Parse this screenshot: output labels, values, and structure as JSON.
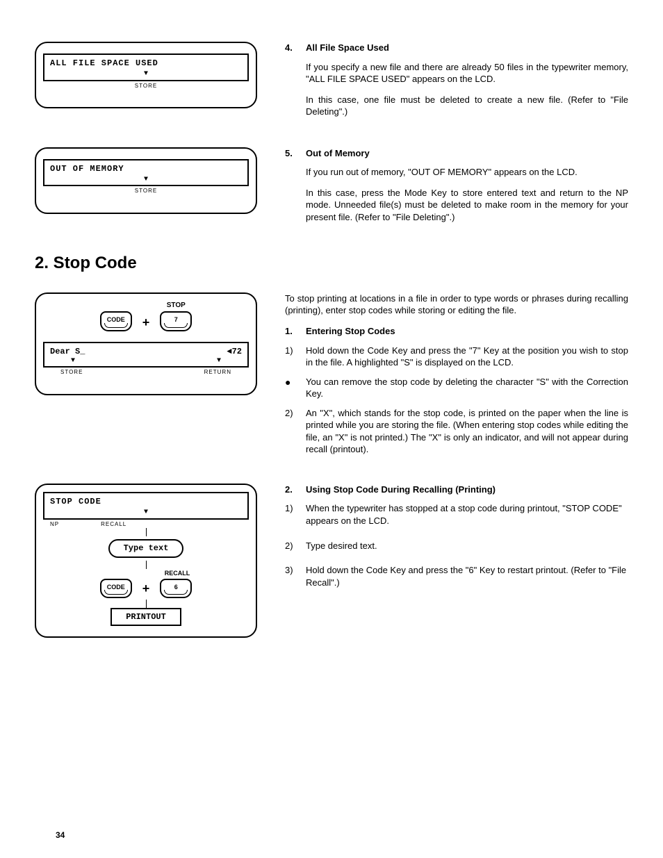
{
  "lcd1": {
    "text": "ALL FILE SPACE USED",
    "sublabel": "STORE"
  },
  "sec4": {
    "num": "4.",
    "title": "All File Space Used",
    "p1": "If you specify a new file and there are already 50 files in the typewriter memory, \"ALL FILE SPACE USED\" appears on the LCD.",
    "p2": "In this case, one file must be deleted to create a new file. (Refer to \"File Deleting\".)"
  },
  "lcd2": {
    "text": "OUT OF MEMORY",
    "sublabel": "STORE"
  },
  "sec5": {
    "num": "5.",
    "title": "Out of Memory",
    "p1": "If you run out of memory, \"OUT OF MEMORY\" appears on the LCD.",
    "p2": "In this case, press the Mode Key to store entered text and return to the NP mode. Unneeded file(s) must be deleted to make room in the memory for your present file. (Refer to \"File Deleting\".)"
  },
  "section2": {
    "title": "2.   Stop Code",
    "intro": "To stop printing at locations in a file in order to type words or phrases during recalling (printing), enter stop codes while storing or editing the file."
  },
  "diag1": {
    "stopLabel": "STOP",
    "keyCode": "CODE",
    "key7": "7",
    "lcdLeft": "Dear S_",
    "lcdRight": "◄72",
    "sublabelL": "STORE",
    "sublabelR": "RETURN"
  },
  "sub1": {
    "num": "1.",
    "title": "Entering Stop Codes",
    "i1n": "1)",
    "i1": "Hold down the Code Key and press the \"7\" Key at the position you wish to stop in the file. A highlighted \"S\" is displayed on the LCD.",
    "ibullet": "You can remove the stop code by deleting the character \"S\" with the Correction Key.",
    "i2n": "2)",
    "i2": "An \"X\", which stands for the stop code, is printed on the paper when the line is printed while you are storing the file. (When entering stop codes while editing the file, an \"X\" is not printed.) The \"X\" is only an indicator, and will not appear during recall (printout)."
  },
  "diag2": {
    "lcdText": "STOP CODE",
    "sublabelL": "NP",
    "sublabelC": "RECALL",
    "typeText": "Type text",
    "recallLabel": "RECALL",
    "keyCode": "CODE",
    "key6": "6",
    "printout": "PRINTOUT"
  },
  "sub2": {
    "num": "2.",
    "title": "Using Stop Code During Recalling (Printing)",
    "i1n": "1)",
    "i1": "When the typewriter has stopped at a stop code during printout, \"STOP CODE\" appears on the LCD.",
    "i2n": "2)",
    "i2": "Type desired text.",
    "i3n": "3)",
    "i3": "Hold down the Code Key and press the \"6\" Key to restart printout. (Refer to \"File Recall\".)"
  },
  "pageNumber": "34"
}
